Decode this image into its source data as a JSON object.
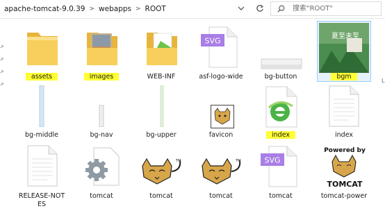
{
  "breadcrumb": [
    "apache-tomcat-9.0.39",
    "webapps",
    "ROOT"
  ],
  "search": {
    "placeholder": "搜索\"ROOT\""
  },
  "files": [
    {
      "name": "assets",
      "type": "folder",
      "highlighted": true
    },
    {
      "name": "images",
      "type": "folder-photo",
      "highlighted": true
    },
    {
      "name": "WEB-INF",
      "type": "folder-doc",
      "highlighted": false
    },
    {
      "name": "asf-logo-wide",
      "type": "svg",
      "highlighted": false
    },
    {
      "name": "bg-button",
      "type": "image-thin",
      "highlighted": false
    },
    {
      "name": "bgm",
      "type": "image-photo",
      "highlighted": true,
      "selected": true
    },
    {
      "name": "bg-middle",
      "type": "bar-blue",
      "highlighted": false
    },
    {
      "name": "bg-nav",
      "type": "bar-gray",
      "highlighted": false
    },
    {
      "name": "bg-upper",
      "type": "bar-green",
      "highlighted": false
    },
    {
      "name": "favicon",
      "type": "favicon",
      "highlighted": false
    },
    {
      "name": "index",
      "type": "html",
      "highlighted": true
    },
    {
      "name": "index",
      "type": "document",
      "highlighted": false
    },
    {
      "name": "RELEASE-NOTES",
      "type": "document",
      "highlighted": false
    },
    {
      "name": "tomcat",
      "type": "gear",
      "highlighted": false
    },
    {
      "name": "tomcat",
      "type": "tomcat-logo",
      "highlighted": false
    },
    {
      "name": "tomcat",
      "type": "tomcat-logo",
      "highlighted": false
    },
    {
      "name": "tomcat",
      "type": "svg",
      "highlighted": false
    },
    {
      "name": "tomcat-power",
      "type": "tomcat-power",
      "highlighted": false
    }
  ],
  "tomcat_power": {
    "line1": "Powered by",
    "line2": "TOMCAT",
    "tm": "TM"
  },
  "svg_badge": "SVG",
  "bgm_text": "夏至未至",
  "colors": {
    "selection": "#e5f1fb",
    "highlight": "#ffff33",
    "folder": "#f7c94d",
    "svg": "#a97ee6"
  }
}
